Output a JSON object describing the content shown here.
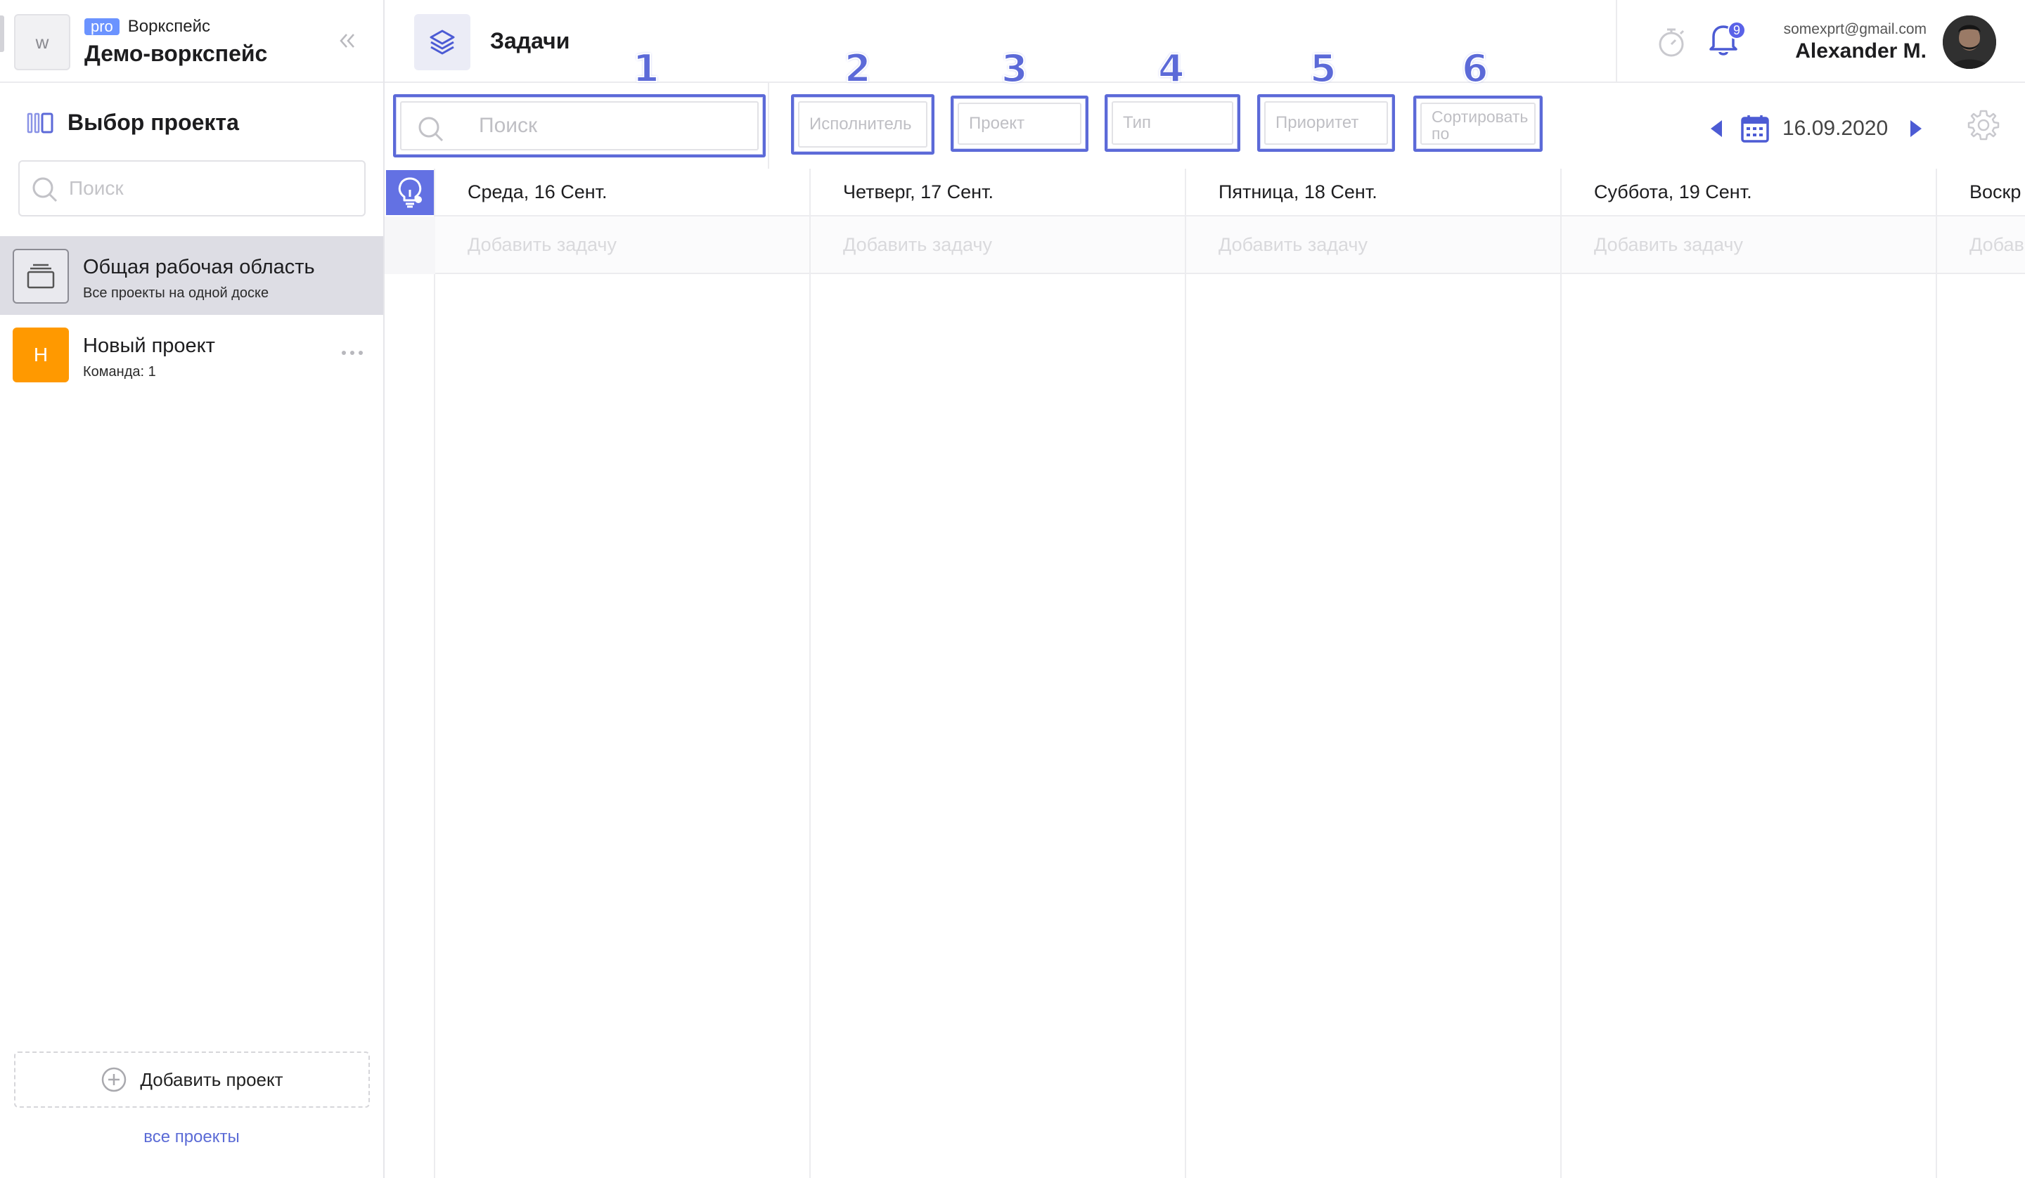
{
  "workspace": {
    "avatar_letter": "w",
    "pro_label": "pro",
    "type_label": "Воркспейс",
    "name": "Демо-воркспейс"
  },
  "sidebar": {
    "title": "Выбор проекта",
    "search_placeholder": "Поиск",
    "projects": [
      {
        "name": "Общая рабочая область",
        "subtitle": "Все проекты на одной доске",
        "icon": "board-icon",
        "active": true
      },
      {
        "name": "Новый проект",
        "subtitle": "Команда: 1",
        "icon_letter": "Н",
        "icon_color": "#ff9900",
        "active": false
      }
    ],
    "add_project_label": "Добавить проект",
    "all_projects_label": "все проекты"
  },
  "header": {
    "section_title": "Задачи",
    "notifications_count": "9",
    "user_email": "somexprt@gmail.com",
    "user_name": "Alexander M."
  },
  "filters": {
    "search_placeholder": "Поиск",
    "assignee_placeholder": "Исполнитель",
    "project_placeholder": "Проект",
    "type_placeholder": "Тип",
    "priority_placeholder": "Приоритет",
    "sort_placeholder": "Сортировать по",
    "annotations": [
      "1",
      "2",
      "3",
      "4",
      "5",
      "6"
    ]
  },
  "date_nav": {
    "date": "16.09.2020"
  },
  "days": [
    {
      "label": "Среда, 16 Сент.",
      "add_label": "Добавить задачу"
    },
    {
      "label": "Четверг, 17 Сент.",
      "add_label": "Добавить задачу"
    },
    {
      "label": "Пятница, 18 Сент.",
      "add_label": "Добавить задачу"
    },
    {
      "label": "Суббота, 19 Сент.",
      "add_label": "Добавить задачу"
    },
    {
      "label": "Воскр",
      "add_label": "Добав"
    }
  ],
  "colors": {
    "accent": "#5c6ad8",
    "accent_button": "#6371e3",
    "orange": "#ff9900",
    "pro_badge": "#6b93ff"
  }
}
